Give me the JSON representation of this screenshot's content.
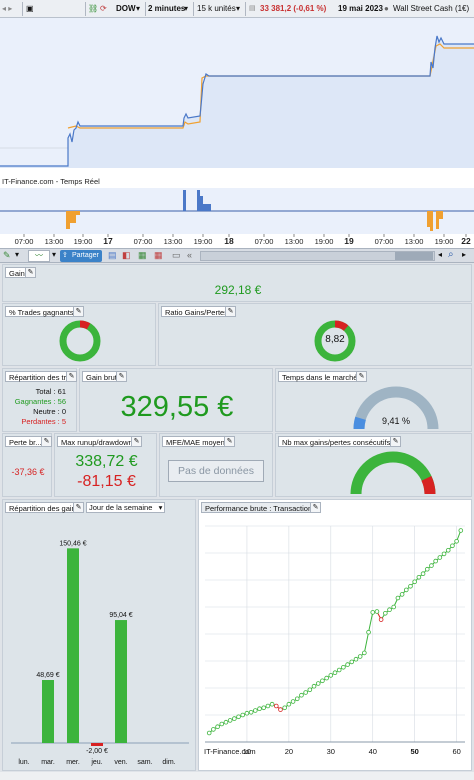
{
  "topbar": {
    "symbol": "DOW",
    "interval": "2 minutes",
    "units": "15 k unités",
    "price": "33 381,2 (-0,61 %)",
    "date": "19 mai 2023",
    "instrument": "Wall Street Cash (1€)"
  },
  "chart": {
    "source_label": "IT-Finance.com - Temps Réel",
    "time_labels": [
      "07:00",
      "13:00",
      "19:00",
      "17",
      "07:00",
      "13:00",
      "19:00",
      "18",
      "07:00",
      "13:00",
      "19:00",
      "19",
      "07:00",
      "13:00",
      "19:00",
      "22"
    ]
  },
  "toolbar2": {
    "share_label": "Partager"
  },
  "panels": {
    "gain": {
      "title": "Gain",
      "value": "292,18 €"
    },
    "pct_trades": {
      "title": "% Trades gagnants"
    },
    "ratio": {
      "title": "Ratio Gains/Pertes",
      "value": "8,82"
    },
    "repartition": {
      "title": "Répartition des tr...",
      "total": "Total : 61",
      "gagnantes": "Gagnantes : 56",
      "neutre": "Neutre : 0",
      "perdantes": "Perdantes : 5"
    },
    "gain_brut": {
      "title": "Gain brut",
      "value": "329,55 €"
    },
    "temps": {
      "title": "Temps dans le marché",
      "value": "9,41 %"
    },
    "perte": {
      "title": "Perte br...",
      "value": "-37,36 €"
    },
    "runup": {
      "title": "Max runup/drawdown",
      "runup": "338,72 €",
      "drawdown": "-81,15 €"
    },
    "mfe": {
      "title": "MFE/MAE moyen",
      "button": "Pas de données"
    },
    "consec": {
      "title": "Nb max gains/pertes consécutifs"
    },
    "rep_gains": {
      "title": "Répartition des gains",
      "select": "Jour de la semaine"
    },
    "perf": {
      "title": "Performance brute : Transactions",
      "source": "IT-Finance.com"
    }
  },
  "chart_data": [
    {
      "type": "bar",
      "categories": [
        "lun.",
        "mar.",
        "mer.",
        "jeu.",
        "ven.",
        "sam.",
        "dim."
      ],
      "values": [
        0,
        48.69,
        150.46,
        -2.0,
        95.04,
        0,
        0
      ],
      "labels": [
        "",
        "48,69 €",
        "150,46 €",
        "-2,00 €",
        "95,04 €",
        "",
        ""
      ],
      "ylim": [
        -5,
        160
      ]
    },
    {
      "type": "line",
      "x_ticks": [
        "10",
        "20",
        "30",
        "40",
        "50",
        "60"
      ],
      "x": [
        1,
        2,
        3,
        4,
        5,
        6,
        7,
        8,
        9,
        10,
        11,
        12,
        13,
        14,
        15,
        16,
        17,
        18,
        19,
        20,
        21,
        22,
        23,
        24,
        25,
        26,
        27,
        28,
        29,
        30,
        31,
        32,
        33,
        34,
        35,
        36,
        37,
        38,
        39,
        40,
        41,
        42,
        43,
        44,
        45,
        46,
        47,
        48,
        49,
        50,
        51,
        52,
        53,
        54,
        55,
        56,
        57,
        58,
        59,
        60,
        61
      ],
      "y": [
        10,
        14,
        17,
        20,
        22,
        24,
        26,
        28,
        30,
        32,
        33,
        35,
        37,
        38,
        40,
        42,
        40,
        36,
        38,
        42,
        45,
        48,
        52,
        55,
        58,
        62,
        65,
        68,
        71,
        74,
        77,
        80,
        83,
        86,
        89,
        92,
        95,
        99,
        122,
        144,
        145,
        136,
        143,
        147,
        150,
        160,
        164,
        169,
        173,
        178,
        183,
        187,
        192,
        196,
        201,
        205,
        209,
        213,
        218,
        223,
        235
      ],
      "losing_points": [
        17,
        18,
        42
      ]
    }
  ],
  "colors": {
    "green": "#3cb43c",
    "red": "#d72222",
    "price_line": "#4a78c8",
    "orange": "#f0a030"
  }
}
